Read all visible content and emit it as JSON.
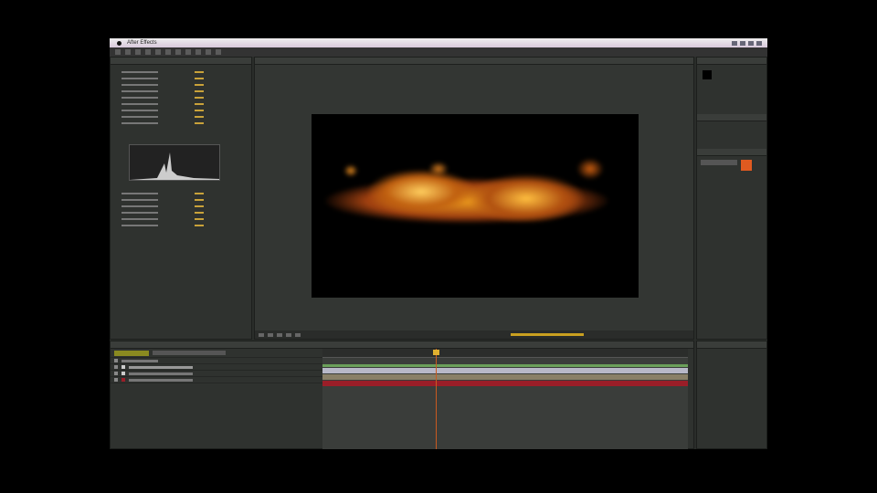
{
  "menubar": {
    "app_name": "After Effects"
  },
  "colors": {
    "accent": "#c9a23a",
    "fire": "#f0a020",
    "layer_red": "#9a1e28",
    "layer_green": "#6aa05a"
  }
}
